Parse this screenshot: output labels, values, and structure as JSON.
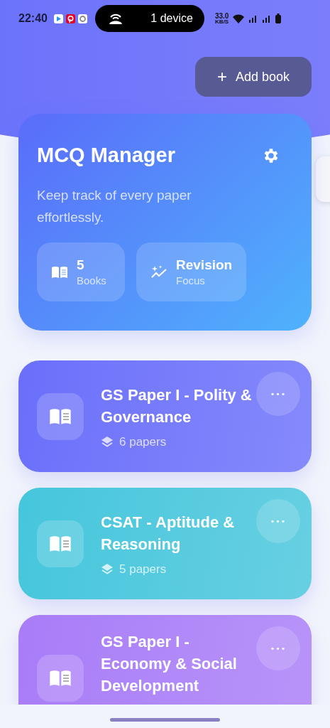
{
  "status_bar": {
    "time": "22:40",
    "pill_text": "1 device",
    "speed_value": "33.0",
    "speed_unit": "KB/S"
  },
  "add_button": {
    "icon": "+",
    "label": "Add book"
  },
  "hero": {
    "title": "MCQ Manager",
    "subtitle": "Keep track of every paper effortlessly.",
    "stats": [
      {
        "kind": "books",
        "value": "5",
        "label": "Books"
      },
      {
        "kind": "focus",
        "value": "Revision",
        "label": "Focus"
      }
    ]
  },
  "books": [
    {
      "title": "GS Paper I - Polity & Governance",
      "count": "6 papers",
      "color": "#6a6ffb"
    },
    {
      "title": "CSAT - Aptitude & Reasoning",
      "count": "5 papers",
      "color": "#45c6dc"
    },
    {
      "title": "GS Paper I - Economy & Social Development",
      "color": "#a97cf8"
    }
  ],
  "more_label": "•••"
}
